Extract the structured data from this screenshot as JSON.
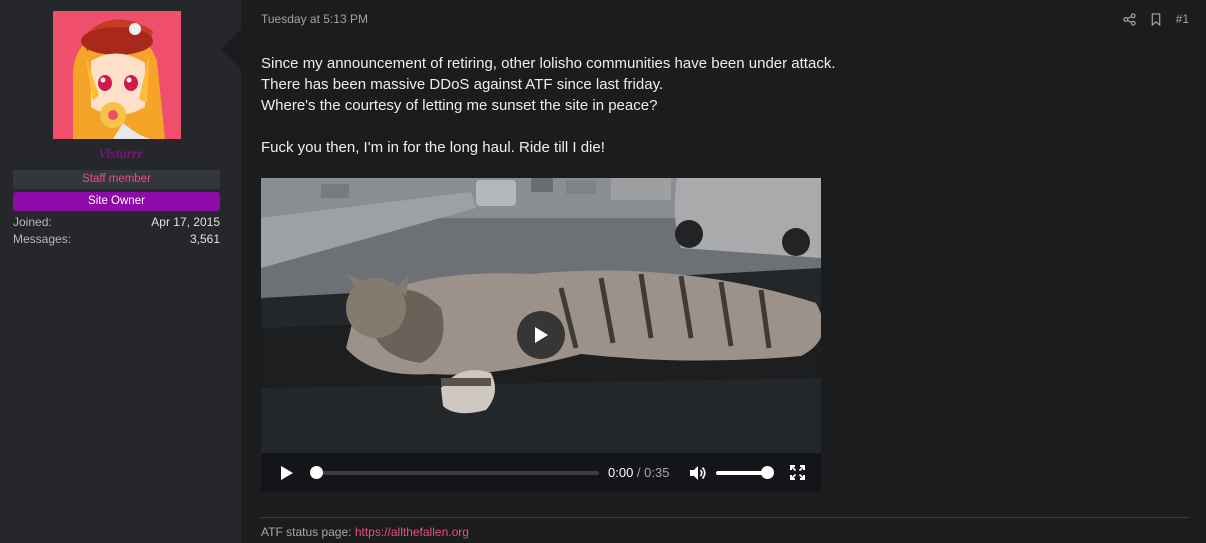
{
  "user": {
    "name": "Vistarrr",
    "badges": {
      "staff": "Staff member",
      "owner": "Site Owner"
    },
    "stats": [
      {
        "label": "Joined:",
        "value": "Apr 17, 2015"
      },
      {
        "label": "Messages:",
        "value": "3,561"
      }
    ]
  },
  "post": {
    "date": "Tuesday at 5:13 PM",
    "number": "#1",
    "paragraphs": [
      "Since my announcement of retiring, other lolisho communities have been under attack.",
      "There has been massive DDoS against ATF since last friday.",
      "Where's the courtesy of letting me sunset the site in peace?",
      "Fuck you then, I'm in for the long haul. Ride till I die!"
    ]
  },
  "video": {
    "current_time": "0:00",
    "separator": " / ",
    "duration": "0:35",
    "progress_fraction": 0,
    "volume_fraction": 1
  },
  "signature": {
    "label": "ATF status page:",
    "link_text": "https://allthefallen.org"
  },
  "colors": {
    "accent_pink": "#e94f84",
    "owner_badge": "#8e0aa9",
    "username": "#7a127f"
  },
  "icons": [
    "share-icon",
    "bookmark-icon",
    "play-icon",
    "volume-icon",
    "fullscreen-icon"
  ]
}
